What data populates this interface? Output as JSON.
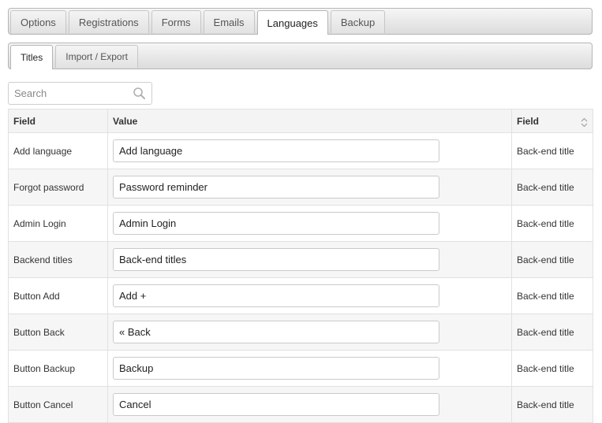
{
  "main_tabs": [
    {
      "label": "Options"
    },
    {
      "label": "Registrations"
    },
    {
      "label": "Forms"
    },
    {
      "label": "Emails"
    },
    {
      "label": "Languages",
      "active": true
    },
    {
      "label": "Backup"
    }
  ],
  "sub_tabs": [
    {
      "label": "Titles",
      "active": true
    },
    {
      "label": "Import / Export"
    }
  ],
  "search": {
    "placeholder": "Search",
    "value": "",
    "icon": "search-icon"
  },
  "table": {
    "headers": [
      "Field",
      "Value",
      "Field"
    ],
    "sort_icon": "sort-arrows-icon",
    "rows": [
      {
        "field": "Add language",
        "value": "Add language",
        "type": "Back-end title"
      },
      {
        "field": "Forgot password",
        "value": "Password reminder",
        "type": "Back-end title"
      },
      {
        "field": "Admin Login",
        "value": "Admin Login",
        "type": "Back-end title"
      },
      {
        "field": "Backend titles",
        "value": "Back-end titles",
        "type": "Back-end title"
      },
      {
        "field": "Button Add",
        "value": "Add +",
        "type": "Back-end title"
      },
      {
        "field": "Button Back",
        "value": "« Back",
        "type": "Back-end title"
      },
      {
        "field": "Button Backup",
        "value": "Backup",
        "type": "Back-end title"
      },
      {
        "field": "Button Cancel",
        "value": "Cancel",
        "type": "Back-end title"
      }
    ]
  }
}
